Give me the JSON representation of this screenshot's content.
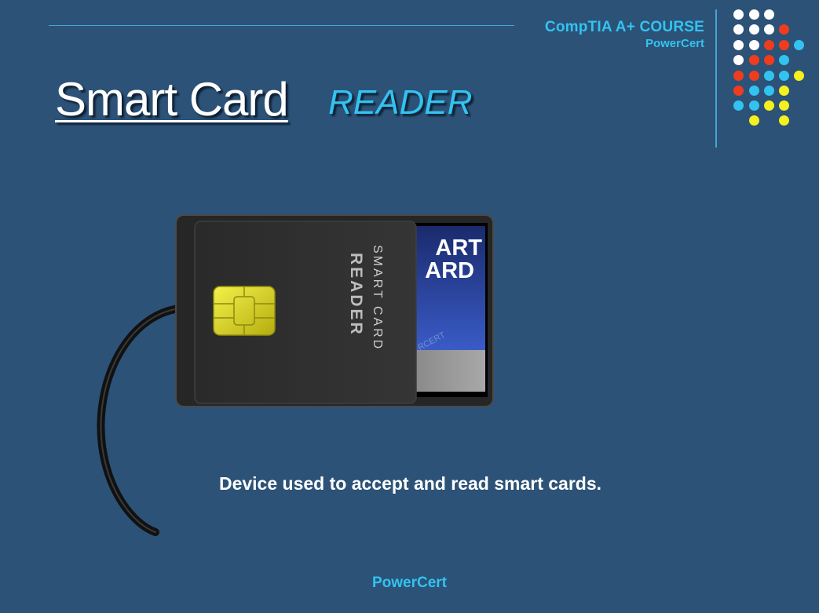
{
  "header": {
    "course_title": "CompTIA A+ COURSE",
    "brand": "PowerCert"
  },
  "slide": {
    "title": "Smart Card",
    "subtitle": "READER",
    "description": "Device used to accept and read smart cards."
  },
  "illustration": {
    "reader_label_line1": "SMART CARD",
    "reader_label_line2": "READER",
    "card_text_line1": "ART",
    "card_text_line2": "ARD",
    "card_watermark": "ERCERT"
  },
  "footer": {
    "brand": "PowerCert"
  },
  "colors": {
    "background": "#2c5277",
    "accent": "#33c3f0",
    "dot_white": "#ffffff",
    "dot_red": "#f03c1e",
    "dot_blue": "#33c3f0",
    "dot_yellow": "#f5f01e"
  }
}
